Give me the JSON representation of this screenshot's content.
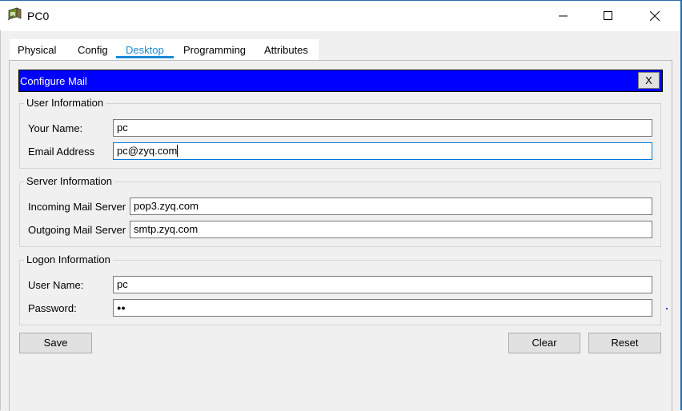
{
  "window": {
    "title": "PC0"
  },
  "tabs": [
    {
      "label": "Physical"
    },
    {
      "label": "Config"
    },
    {
      "label": "Desktop",
      "active": true
    },
    {
      "label": "Programming"
    },
    {
      "label": "Attributes"
    }
  ],
  "dialog": {
    "title": "Configure Mail",
    "close_label": "X"
  },
  "user_info": {
    "title": "User Information",
    "name_label": "Your Name:",
    "name_value": "pc",
    "email_label": "Email Address",
    "email_value": "pc@zyq.com"
  },
  "server_info": {
    "title": "Server Information",
    "incoming_label": "Incoming Mail Server",
    "incoming_value": "pop3.zyq.com",
    "outgoing_label": "Outgoing Mail Server",
    "outgoing_value": "smtp.zyq.com"
  },
  "logon_info": {
    "title": "Logon Information",
    "username_label": "User Name:",
    "username_value": "pc",
    "password_label": "Password:",
    "password_value": "●●"
  },
  "buttons": {
    "save": "Save",
    "clear": "Clear",
    "reset": "Reset"
  },
  "colors": {
    "header_bg": "#0000ff",
    "tab_active": "#1a8ad4"
  }
}
